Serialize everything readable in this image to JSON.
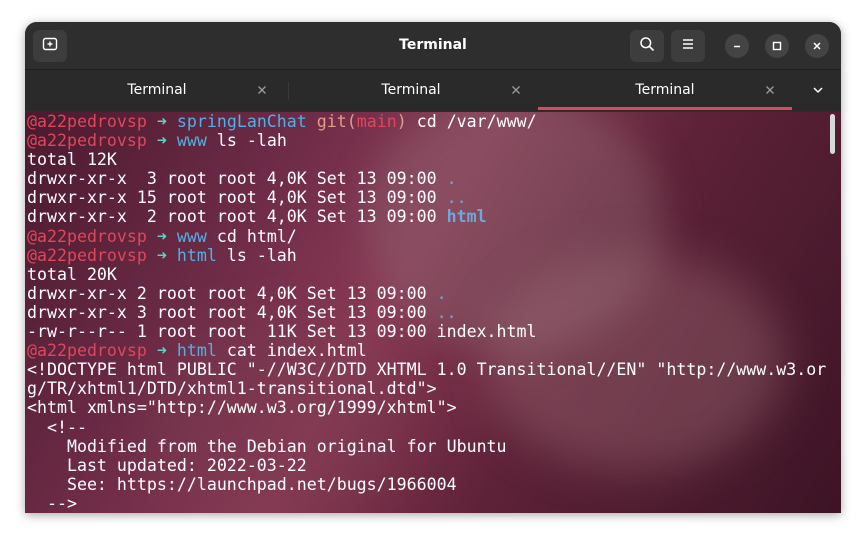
{
  "window": {
    "title": "Terminal"
  },
  "tabs": [
    {
      "label": "Terminal",
      "active": false
    },
    {
      "label": "Terminal",
      "active": false
    },
    {
      "label": "Terminal",
      "active": true
    }
  ],
  "colors": {
    "accent": "#e0465e",
    "prompt_user": "#e0465e",
    "prompt_arrow": "#5fd3c1",
    "prompt_dir": "#4fb0e6"
  },
  "terminal": {
    "prompt_user": "@a22pedrovsp",
    "prompt_arrow": "➜",
    "lines": [
      {
        "kind": "prompt",
        "dir": "springLanChat",
        "git": "git:(main)",
        "cmd": "cd /var/www/"
      },
      {
        "kind": "prompt",
        "dir": "www",
        "cmd": "ls -lah"
      },
      {
        "kind": "text",
        "text": "total 12K"
      },
      {
        "kind": "ls",
        "text": "drwxr-xr-x  3 root root 4,0K Set 13 09:00 ",
        "name": ".",
        "style": "dir"
      },
      {
        "kind": "ls",
        "text": "drwxr-xr-x 15 root root 4,0K Set 13 09:00 ",
        "name": "..",
        "style": "dir"
      },
      {
        "kind": "ls",
        "text": "drwxr-xr-x  2 root root 4,0K Set 13 09:00 ",
        "name": "html",
        "style": "bold"
      },
      {
        "kind": "prompt",
        "dir": "www",
        "cmd": "cd html/"
      },
      {
        "kind": "prompt",
        "dir": "html",
        "cmd": "ls -lah"
      },
      {
        "kind": "text",
        "text": "total 20K"
      },
      {
        "kind": "ls",
        "text": "drwxr-xr-x 2 root root 4,0K Set 13 09:00 ",
        "name": ".",
        "style": "dir"
      },
      {
        "kind": "ls",
        "text": "drwxr-xr-x 3 root root 4,0K Set 13 09:00 ",
        "name": "..",
        "style": "dir"
      },
      {
        "kind": "ls",
        "text": "-rw-r--r-- 1 root root  11K Set 13 09:00 ",
        "name": "index.html",
        "style": "plain"
      },
      {
        "kind": "prompt",
        "dir": "html",
        "cmd": "cat index.html"
      },
      {
        "kind": "text",
        "text": "<!DOCTYPE html PUBLIC \"-//W3C//DTD XHTML 1.0 Transitional//EN\" \"http://www.w3.or"
      },
      {
        "kind": "text",
        "text": "g/TR/xhtml1/DTD/xhtml1-transitional.dtd\">"
      },
      {
        "kind": "text",
        "text": "<html xmlns=\"http://www.w3.org/1999/xhtml\">"
      },
      {
        "kind": "text",
        "text": "  <!--"
      },
      {
        "kind": "text",
        "text": "    Modified from the Debian original for Ubuntu"
      },
      {
        "kind": "text",
        "text": "    Last updated: 2022-03-22"
      },
      {
        "kind": "text",
        "text": "    See: https://launchpad.net/bugs/1966004"
      },
      {
        "kind": "text",
        "text": "  -->"
      }
    ]
  }
}
